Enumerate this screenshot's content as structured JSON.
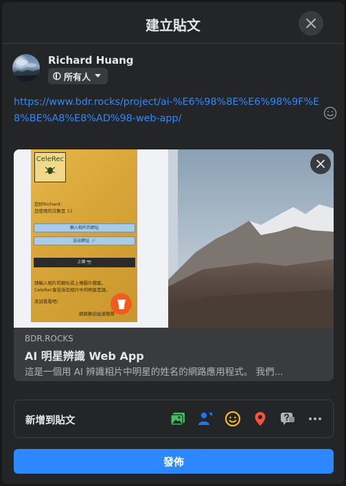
{
  "header": {
    "title": "建立貼文"
  },
  "author": {
    "name": "Richard Huang",
    "audience": "所有人"
  },
  "post": {
    "text": "https://www.bdr.rocks/project/ai-%E6%98%8E%E6%98%9F%E8%BE%A8%E8%AD%98-web-app/"
  },
  "preview": {
    "app_screen": {
      "logo_text": "CeleRec",
      "greeting": "您好Richard：",
      "usage_count": "您使用的次數是 11",
      "input_placeholder": "輸入相片的網址",
      "submit_label": "送出網址 🔗",
      "upload_label": "上傳 📷",
      "instruction": "請輸入相片的網址或上傳圖片檔案，",
      "instruction2": "CeleRec會告訴您相片中的明星是誰。",
      "cta": "來試看看吧!",
      "footer": "網頁歡迎由道敬隊"
    },
    "domain": "BDR.ROCKS",
    "title": "AI 明星辨識 Web App",
    "description": "這是一個用 AI 辨識相片中明星的姓名的網路應用程式。 我們..."
  },
  "add_to_post": {
    "label": "新增到貼文",
    "tools": [
      "photo-video",
      "tag-people",
      "feeling-activity",
      "check-in",
      "ask-recommendations",
      "more"
    ]
  },
  "publish_label": "發佈",
  "colors": {
    "accent": "#2d88ff",
    "background": "#242526",
    "divider": "#3e4042"
  }
}
